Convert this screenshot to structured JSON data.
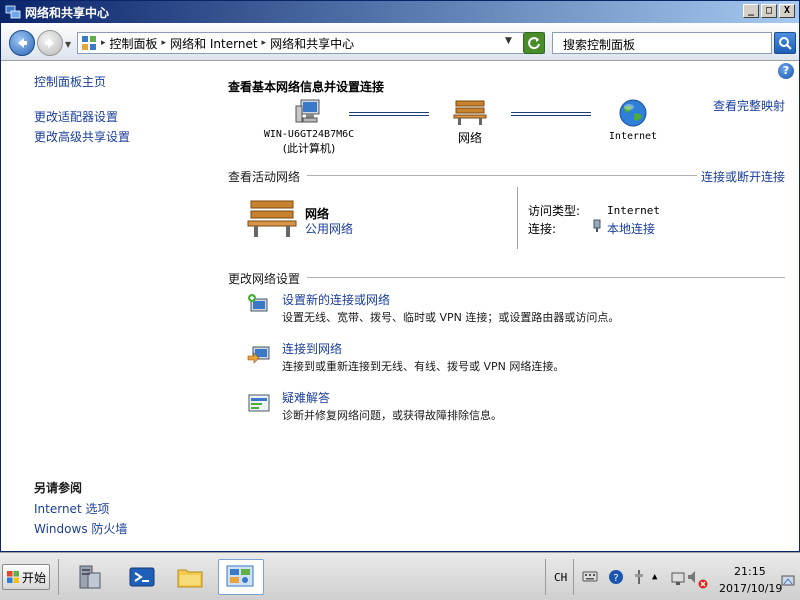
{
  "window": {
    "title": "网络和共享中心",
    "buttons": {
      "minimize": "_",
      "maximize": "□",
      "close": "X"
    }
  },
  "address_bar": {
    "breadcrumbs": [
      "控制面板",
      "网络和 Internet",
      "网络和共享中心"
    ],
    "search_placeholder": "搜索控制面板"
  },
  "sidebar": {
    "links": [
      "控制面板主页",
      "更改适配器设置",
      "更改高级共享设置"
    ],
    "see_also_heading": "另请参阅",
    "see_also_links": [
      "Internet 选项",
      "Windows 防火墙"
    ]
  },
  "main": {
    "title": "查看基本网络信息并设置连接",
    "full_map_link": "查看完整映射",
    "network_map": {
      "computer_name": "WIN-U6GT24B7M6C",
      "computer_note": "(此计算机)",
      "network_label": "网络",
      "internet_label": "Internet"
    },
    "active_networks": {
      "title": "查看活动网络",
      "connect_link": "连接或断开连接",
      "network_name": "网络",
      "network_type": "公用网络",
      "access_type_label": "访问类型:",
      "access_type_value": "Internet",
      "connections_label": "连接:",
      "connections_value": "本地连接"
    },
    "change_settings": {
      "title": "更改网络设置",
      "tasks": [
        {
          "link": "设置新的连接或网络",
          "desc": "设置无线、宽带、拨号、临时或 VPN 连接；或设置路由器或访问点。"
        },
        {
          "link": "连接到网络",
          "desc": "连接到或重新连接到无线、有线、拨号或 VPN 网络连接。"
        },
        {
          "link": "疑难解答",
          "desc": "诊断并修复网络问题，或获得故障排除信息。"
        }
      ]
    }
  },
  "taskbar": {
    "start_label": "开始",
    "language": "CH",
    "time": "21:15",
    "date": "2017/10/19"
  }
}
